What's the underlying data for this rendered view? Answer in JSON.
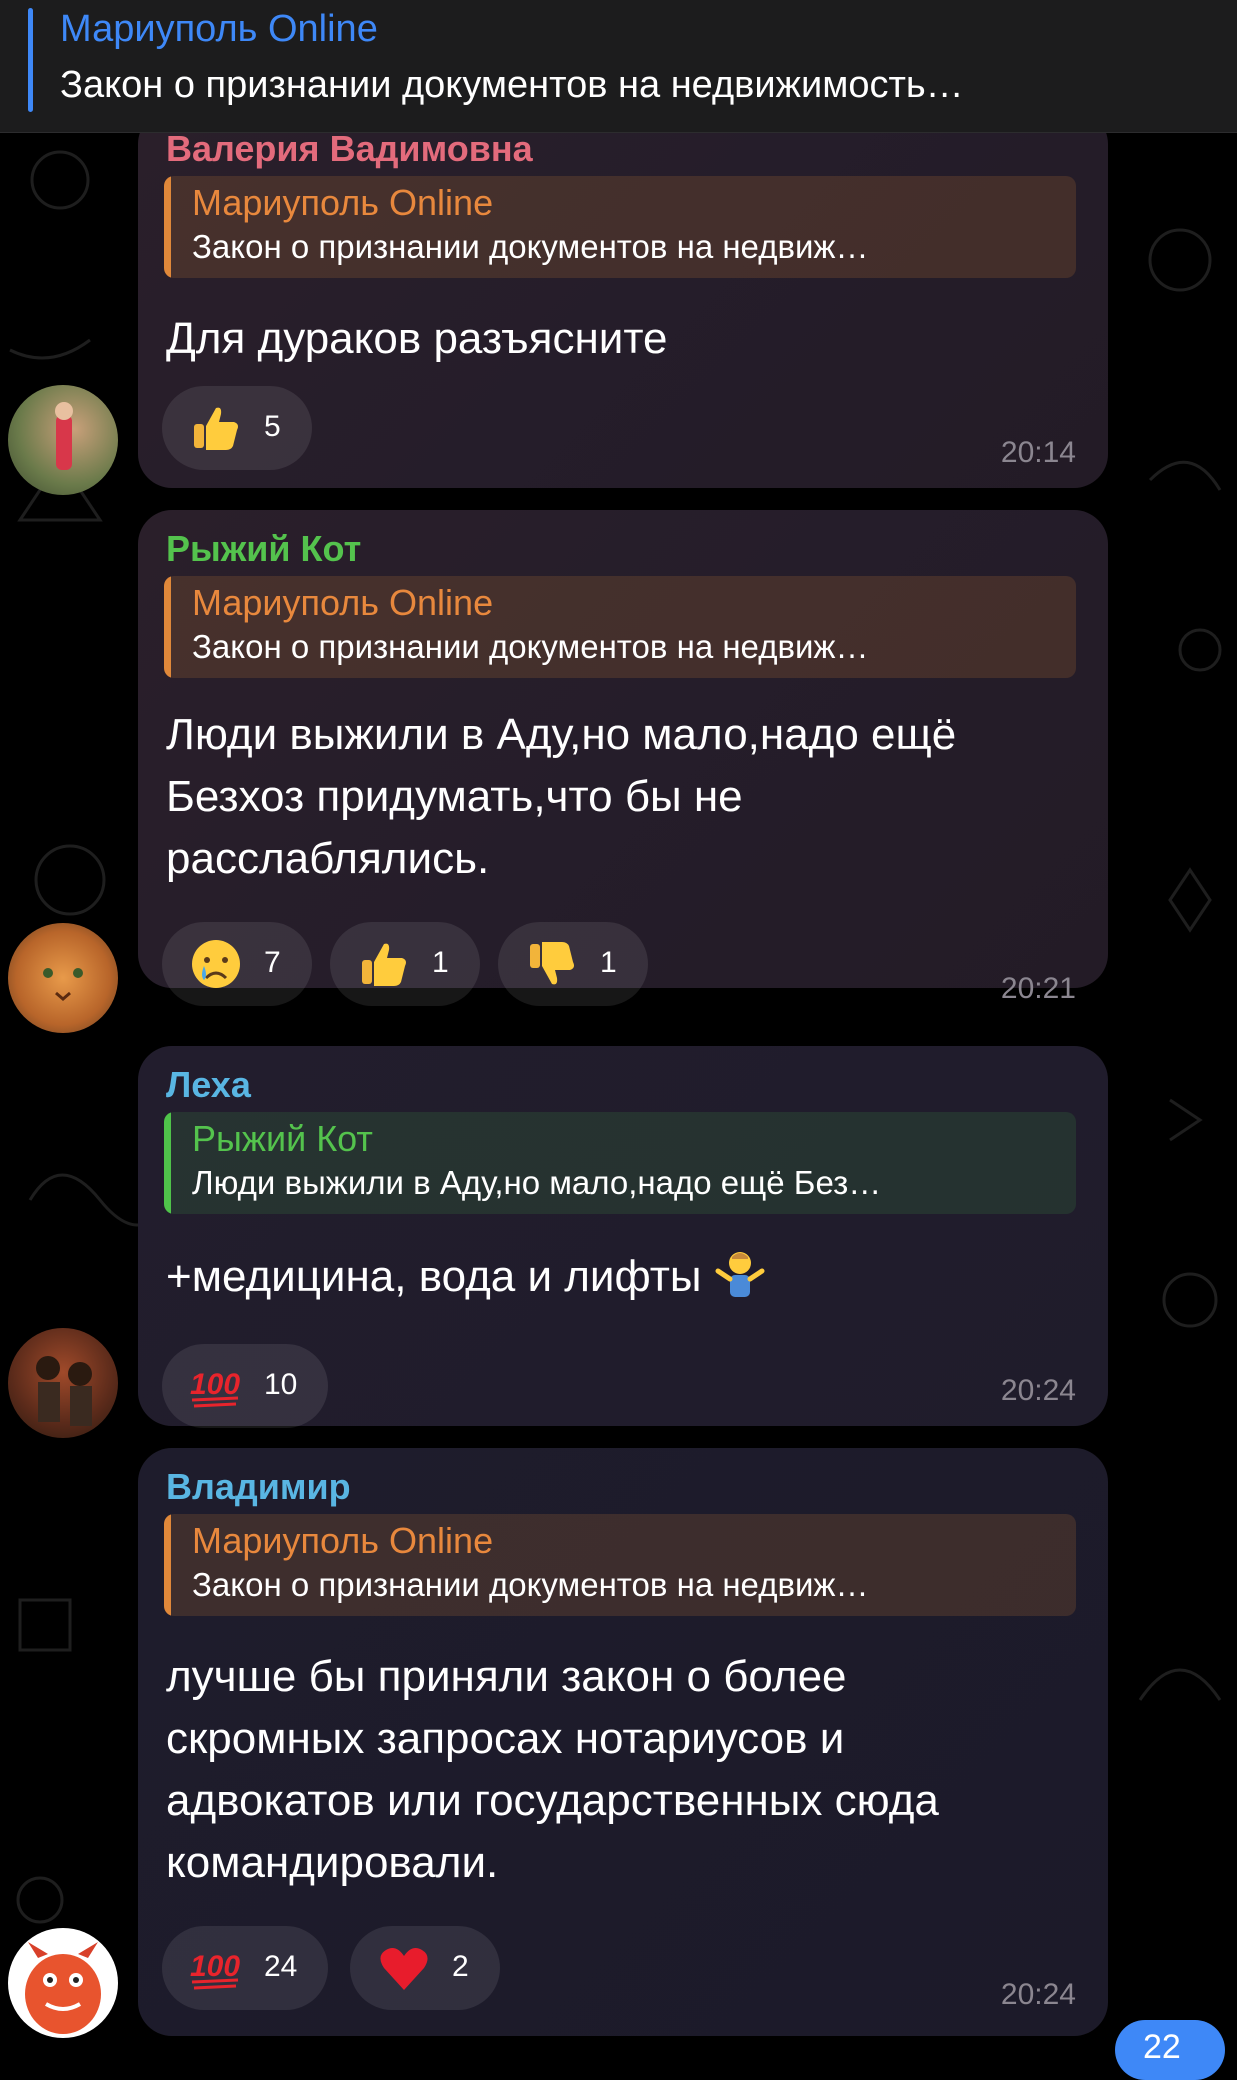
{
  "pinned": {
    "title": "Мариуполь Online",
    "text": "Закон о признании документов на недвижимость…"
  },
  "messages": [
    {
      "author": "Валерия Вадимовна",
      "quote_title": "Мариуполь Online",
      "quote_text": "Закон о признании документов на недвиж…",
      "lines": [
        "Для дураков разъясните"
      ],
      "reactions": [
        {
          "emoji": "thumbs-up",
          "count": "5"
        }
      ],
      "time": "20:14"
    },
    {
      "author": "Рыжий Кот",
      "quote_title": "Мариуполь Online",
      "quote_text": "Закон о признании документов на недвиж…",
      "lines": [
        "Люди выжили в Аду,но мало,надо ещё",
        "Безхоз придумать,что бы не",
        "расслаблялись."
      ],
      "reactions": [
        {
          "emoji": "crying-face",
          "count": "7"
        },
        {
          "emoji": "thumbs-up",
          "count": "1"
        },
        {
          "emoji": "thumbs-down",
          "count": "1"
        }
      ],
      "time": "20:21"
    },
    {
      "author": "Леха",
      "quote_title": "Рыжий Кот",
      "quote_text": "Люди выжили в Аду,но мало,надо ещё Без…",
      "lines": [
        "+медицина, вода и лифты"
      ],
      "reactions": [
        {
          "emoji": "hundred-points",
          "count": "10"
        }
      ],
      "time": "20:24"
    },
    {
      "author": "Владимир",
      "quote_title": "Мариуполь Online",
      "quote_text": "Закон о признании документов на недвиж…",
      "lines": [
        "лучше бы приняли закон о более",
        "скромных запросах нотариусов и",
        "адвокатов или государственных сюда",
        "командировали."
      ],
      "reactions": [
        {
          "emoji": "hundred-points",
          "count": "24"
        },
        {
          "emoji": "red-heart",
          "count": "2"
        }
      ],
      "time": "20:24"
    }
  ],
  "unread_badge": "22",
  "colors": {
    "accent_blue": "#3e88f7",
    "author_valeria": "#e36b7c",
    "author_ryzhiy": "#54c34d",
    "author_lekha": "#59b6e3",
    "author_vladimir": "#59b6e3",
    "quote_orange": "#e8883d",
    "quote_green": "#54c34d"
  }
}
